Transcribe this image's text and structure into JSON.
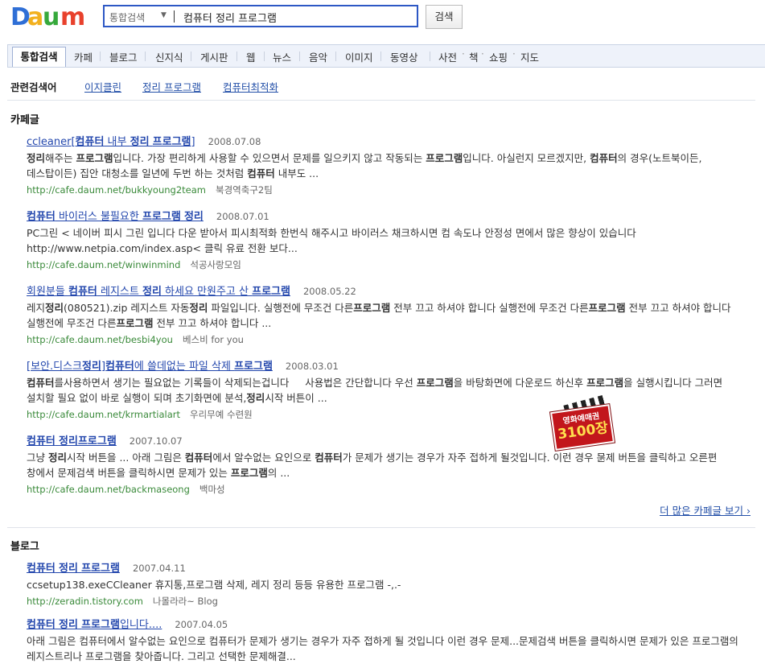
{
  "header": {
    "logo": "Daum",
    "search_scope": "통합검색",
    "query": "컴퓨터 정리 프로그램",
    "search_button": "검색"
  },
  "tabs": [
    {
      "label": "통합검색",
      "active": true
    },
    {
      "label": "카페"
    },
    {
      "label": "블로그"
    },
    {
      "label": "신지식"
    },
    {
      "label": "게시판"
    },
    {
      "label": "웹"
    },
    {
      "label": "뉴스"
    },
    {
      "label": "음악"
    },
    {
      "label": "이미지"
    },
    {
      "label": "동영상"
    },
    {
      "label": "사전"
    },
    {
      "label": "책"
    },
    {
      "label": "쇼핑"
    },
    {
      "label": "지도"
    }
  ],
  "related": {
    "label": "관련검색어",
    "items": [
      "이지클린",
      "정리 프로그램",
      "컴퓨터최적화"
    ]
  },
  "cafe": {
    "title": "카페글",
    "results": [
      {
        "title_html": "ccleaner[<b>컴퓨터</b> 내부 <b>정리</b> <b>프로그램</b>]",
        "date": "2008.07.08",
        "snippet_html": "<b>정리</b>해주는 <b>프로그램</b>입니다. 가장 편리하게 사용할 수 있으면서 문제를 일으키지 않고 작동되는 <b>프로그램</b>입니다. 아실런지 모르겠지만, <b>컴퓨터</b>의 경우(노트북이든, 데스탑이든) 집안 대청소를 일년에 두번 하는 것처럼 <b>컴퓨터</b> 내부도 ...",
        "url": "http://cafe.daum.net/bukkyoung2team",
        "source": "북경역축구2팀"
      },
      {
        "title_html": "<b>컴퓨터</b> 바이러스 불필요한 <b>프로그램</b> <b>정리</b>",
        "date": "2008.07.01",
        "snippet_html": "PC그린 &lt; 네이버 피시 그린 입니다 다운 받아서 피시최적화 한번식 해주시고 바이러스 채크하시면 컴 속도나 안정성 면에서 많은 향상이 있습니다 http://www.netpia.com/index.asp&lt; 클릭 유료 전환 보다...",
        "url": "http://cafe.daum.net/winwinmind",
        "source": "석공사랑모임"
      },
      {
        "title_html": "회원분들 <b>컴퓨터</b> 레지스트 <b>정리</b> 하세요 만원주고 산 <b>프로그램</b>",
        "date": "2008.05.22",
        "snippet_html": "레지<b>정리</b>(080521).zip 레지스트 자동<b>정리</b> 파일입니다. 실행전에 무조건 다른<b>프로그램</b> 전부 끄고 하셔야 합니다 실행전에 무조건 다른<b>프로그램</b> 전부 끄고 하셔야 합니다 실행전에 무조건 다른<b>프로그램</b> 전부 끄고 하셔야 합니다 ...",
        "url": "http://cafe.daum.net/besbi4you",
        "source": "베스비 for you"
      },
      {
        "title_html": "[보안.디스크<b>정리</b>]<b>컴퓨터</b>에 쓸데없는 파일 삭제 <b>프로그램</b>",
        "date": "2008.03.01",
        "snippet_html": "<b>컴퓨터</b>를사용하면서 생기는 필요없는 기록들이 삭제되는겁니다 &nbsp;&nbsp;&nbsp; 사용법은 간단합니다 우선 <b>프로그램</b>을 바탕화면에 다운로드 하신후 <b>프로그램</b>을 실행시킵니다 그러면 설치할 필요 없이 바로 실행이 되며 초기화면에 분석,<b>정리</b>시작 버튼이 ...",
        "url": "http://cafe.daum.net/krmartialart",
        "source": "우리무예 수련원"
      },
      {
        "title_html": "<b>컴퓨터</b> <b>정리프로그램</b>",
        "date": "2007.10.07",
        "snippet_html": "그냥 <b>정리</b>시작 버튼을 ... 아래 그림은 <b>컴퓨터</b>에서 알수없는 요인으로 <b>컴퓨터</b>가 문제가 생기는 경우가 자주 접하게 될것입니다. 이런 경우 문제 버튼을 클릭하고 오른편 창에서 문제검색 버튼을 클릭하시면 문제가 있는 <b>프로그램</b>의 ...",
        "url": "http://cafe.daum.net/backmaseong",
        "source": "백마성"
      }
    ],
    "more": "더 많은 카페글 보기 ›"
  },
  "blog": {
    "title": "블로그",
    "results": [
      {
        "title_html": "<b>컴퓨터</b> <b>정리</b> <b>프로그램</b>",
        "date": "2007.04.11",
        "snippet_html": "ccsetup138.exeCCleaner 휴지통,프로그램 삭제, 레지 정리 등등 유용한 프로그램 -,.-",
        "url": "http://zeradin.tistory.com",
        "source": "나몰라라~ Blog"
      },
      {
        "title_html": "<b>컴퓨터</b> <b>정리</b> <b>프로그램</b>입니다....",
        "date": "2007.04.05",
        "snippet_html": "아래 그림은 컴퓨터에서 알수없는 요인으로 컴퓨터가 문제가 생기는 경우가 자주 접하게 될 것입니다 이런 경우 문제...문제검색 버튼을 클릭하시면 문제가 있은 프로그램의 레지스트리나 프로그램을 찾아줍니다. 그리고 선택한 문제해결...",
        "url": "",
        "source": ""
      }
    ]
  },
  "ad": {
    "line1": "영화예매권",
    "line2": "3100장",
    "close": "×"
  },
  "colors": {
    "search_border": "#2d58c5",
    "link_blue": "#2347ad",
    "url_green": "#3a8a3a"
  }
}
